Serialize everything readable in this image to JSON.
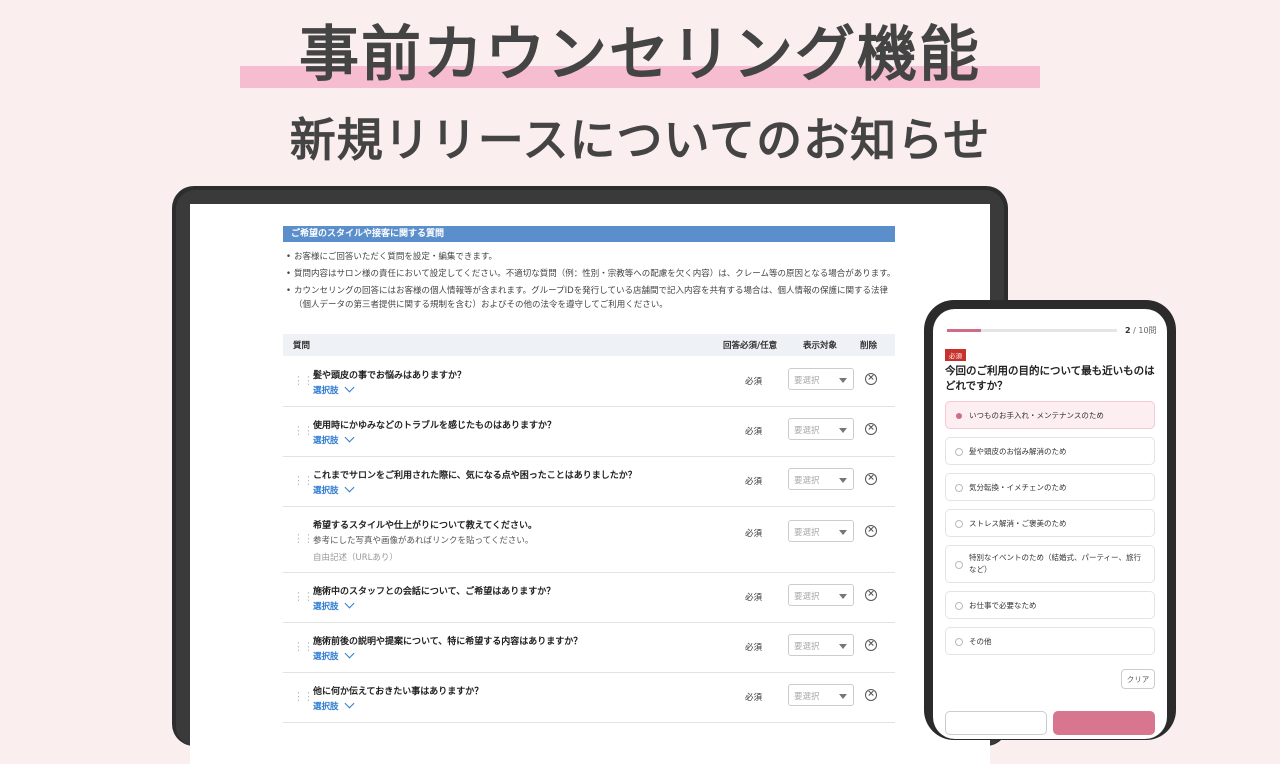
{
  "headline": "事前カウンセリング機能",
  "subheadline": "新規リリースについてのお知らせ",
  "admin": {
    "section_title": "ご希望のスタイルや接客に関する質問",
    "notes": [
      "お客様にご回答いただく質問を設定・編集できます。",
      "質問内容はサロン様の責任において設定してください。不適切な質問（例：性別・宗教等への配慮を欠く内容）は、クレーム等の原因となる場合があります。",
      "カウンセリングの回答にはお客様の個人情報等が含まれます。グループIDを発行している店舗間で記入内容を共有する場合は、個人情報の保護に関する法律（個人データの第三者提供に関する規制を含む）およびその他の法令を遵守してご利用ください。"
    ],
    "columns": {
      "question": "質問",
      "required": "回答必須/任意",
      "target": "表示対象",
      "delete": "削除"
    },
    "rows": [
      {
        "q": "髪や頭皮の事でお悩みはありますか？",
        "choice": "選択肢",
        "req": "必須",
        "sel": "要選択"
      },
      {
        "q": "使用時にかゆみなどのトラブルを感じたものはありますか？",
        "choice": "選択肢",
        "req": "必須",
        "sel": "要選択"
      },
      {
        "q": "これまでサロンをご利用された際に、気になる点や困ったことはありましたか？",
        "choice": "選択肢",
        "req": "必須",
        "sel": "要選択"
      },
      {
        "q": "希望するスタイルや仕上がりについて教えてください。",
        "sub": "参考にした写真や画像があればリンクを貼ってください。",
        "sub2": "自由記述（URLあり）",
        "req": "必須",
        "sel": "要選択"
      },
      {
        "q": "施術中のスタッフとの会話について、ご希望はありますか？",
        "choice": "選択肢",
        "req": "必須",
        "sel": "要選択"
      },
      {
        "q": "施術前後の説明や提案について、特に希望する内容はありますか？",
        "choice": "選択肢",
        "req": "必須",
        "sel": "要選択"
      },
      {
        "q": "他に何か伝えておきたい事はありますか？",
        "choice": "選択肢",
        "req": "必須",
        "sel": "要選択"
      }
    ]
  },
  "phone": {
    "progress": 0.2,
    "page_current": "2",
    "page_total": " / 10問",
    "required_badge": "必須",
    "question": "今回のご利用の目的について最も近いものはどれですか？",
    "options": [
      "いつものお手入れ・メンテナンスのため",
      "髪や頭皮のお悩み解消のため",
      "気分転換・イメチェンのため",
      "ストレス解消・ご褒美のため",
      "特別なイベントのため（結婚式、パーティー、旅行など）",
      "お仕事で必要なため",
      "その他"
    ],
    "selected_index": 0,
    "clear_label": "クリア"
  },
  "colors": {
    "background": "#fbeeee",
    "highlight": "#f6bdd1",
    "section_bar": "#5b8fcc",
    "link": "#2f7bd1",
    "accent": "#d06c85",
    "badge": "#c8302c"
  }
}
